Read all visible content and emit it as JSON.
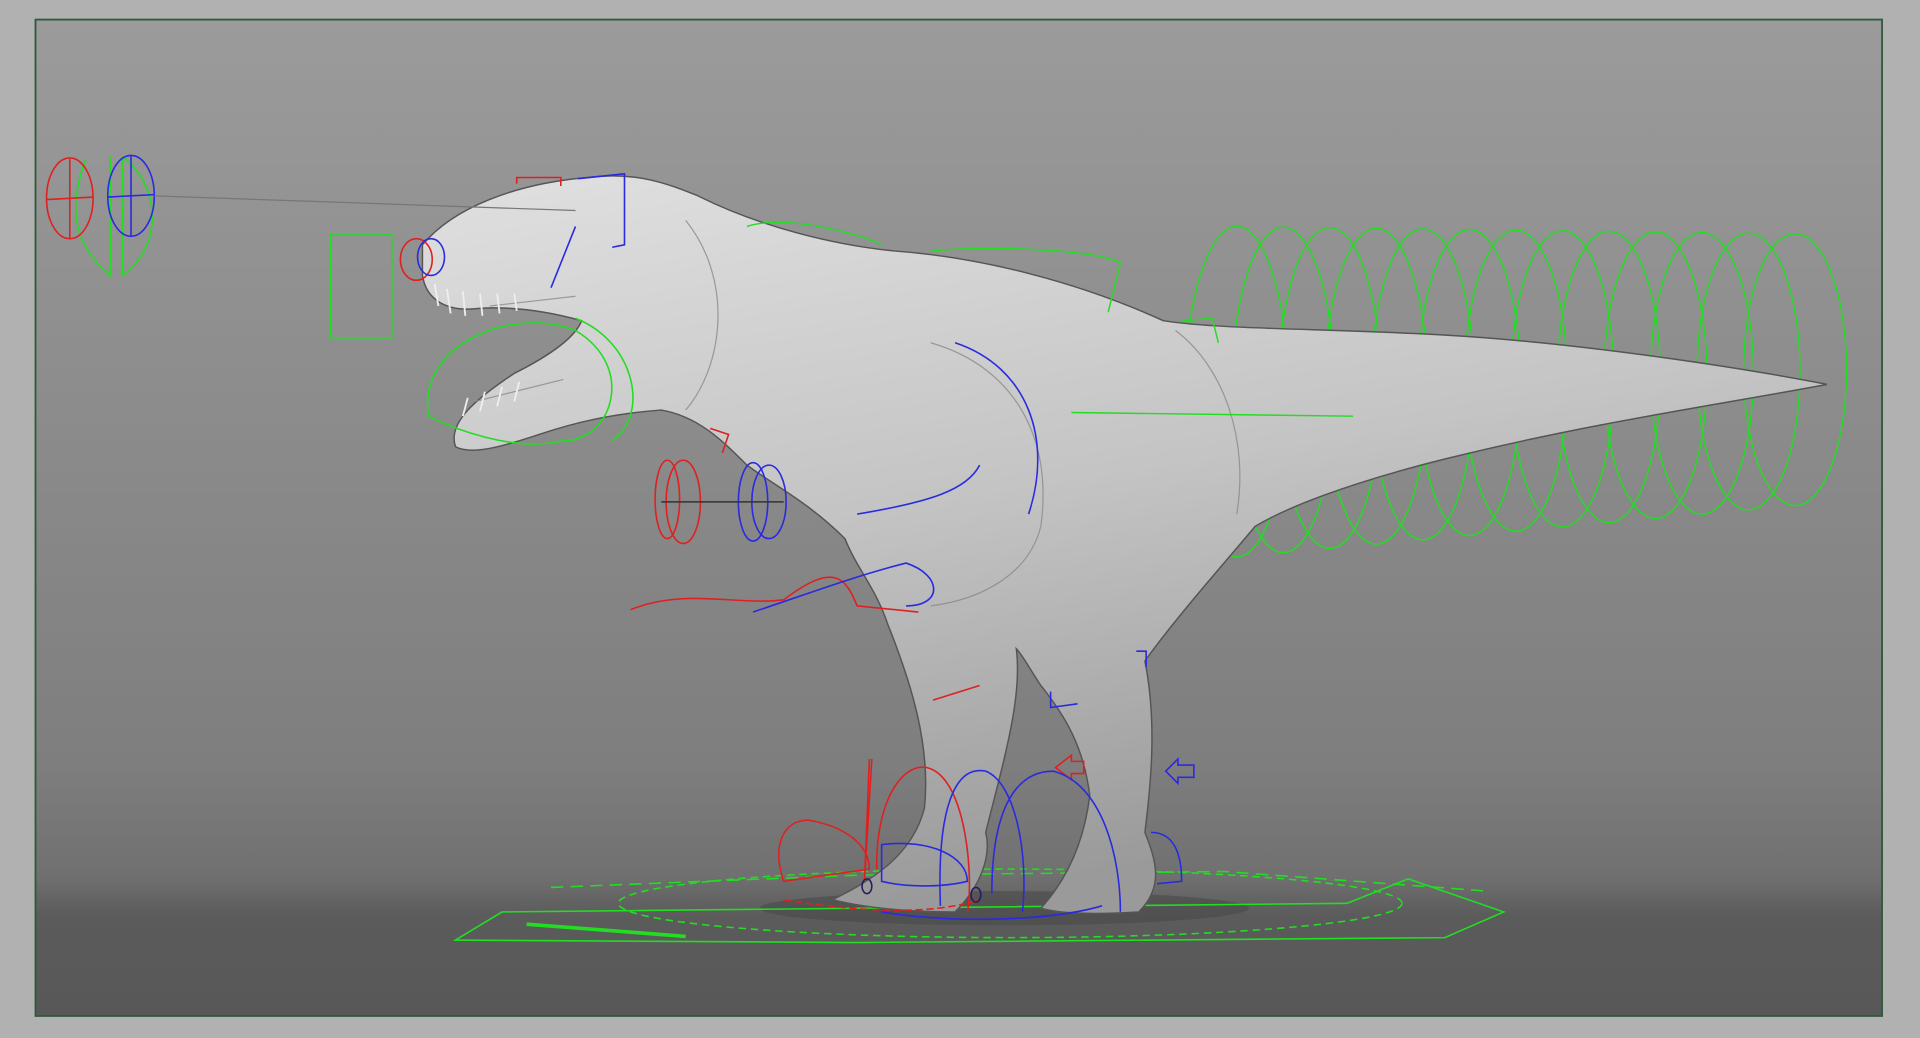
{
  "viewport": {
    "name": "3d-viewport",
    "colors": {
      "outer_background": "#b1b1b1",
      "frame_border": "#2f5a3a",
      "sky_top": "#9a9a9a",
      "sky_bottom": "#7c7c7c",
      "ground": "#5a5a5a",
      "model_light": "#d6d6d6",
      "model_dark": "#8a8a8a",
      "control_green": "#22dd22",
      "control_red": "#e02020",
      "control_blue": "#2a2ae0"
    },
    "scene": {
      "model": "t-rex-mesh",
      "rig_controls": [
        "eye-aim-controls",
        "jaw-controls",
        "tail-ring-controls",
        "arm-controls",
        "leg-ik-controls",
        "foot-controls",
        "ground-placement-control"
      ]
    }
  }
}
